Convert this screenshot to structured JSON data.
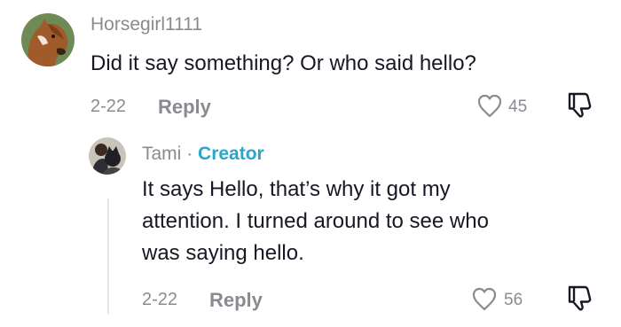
{
  "comments": [
    {
      "username": "Horsegirl1111",
      "text": "Did it say something? Or who said hello?",
      "date": "2-22",
      "reply_label": "Reply",
      "likes": "45",
      "avatar_icon": "horse-avatar-icon"
    }
  ],
  "reply": {
    "username": "Tami",
    "separator": "·",
    "badge": "Creator",
    "text_lines": [
      "It says Hello, that’s why it got my",
      "attention. I turned around to see who",
      "was saying hello."
    ],
    "date": "2-22",
    "reply_label": "Reply",
    "likes": "56",
    "avatar_icon": "person-with-dog-avatar-icon"
  },
  "colors": {
    "text": "#161823",
    "muted": "#8a8b91",
    "creator": "#2aa6c9"
  }
}
